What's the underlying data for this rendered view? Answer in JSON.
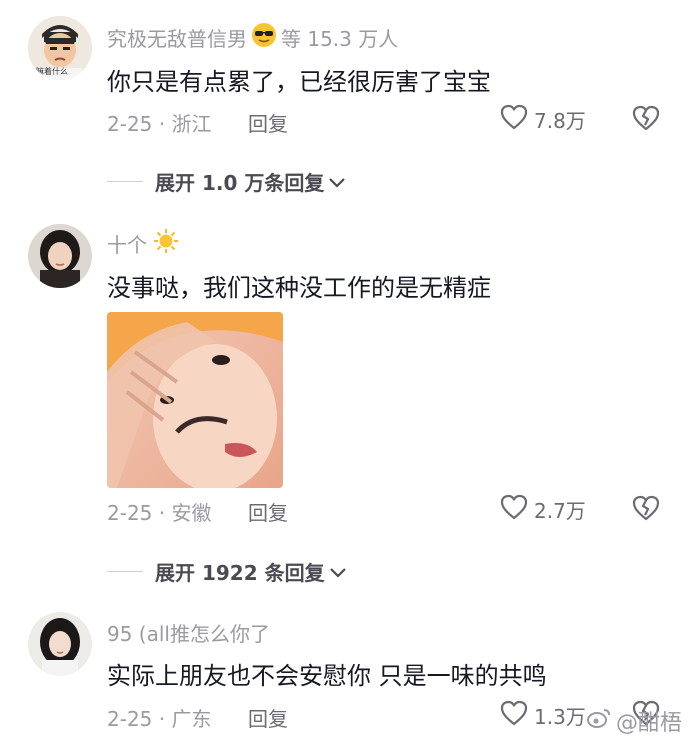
{
  "comments": [
    {
      "username": "究极无敌普信男",
      "emoji": "sunglasses-emoji",
      "username_suffix": "等 15.3 万人",
      "avatar_caption": "嘛着什么",
      "text": "你只是有点累了，已经很厉害了宝宝",
      "date_location": "2-25 · 浙江",
      "reply_label": "回复",
      "likes": "7.8万",
      "expand_label": "展开 1.0 万条回复"
    },
    {
      "username": "十个",
      "emoji": "sun-emoji",
      "text": "没事哒，我们这种没工作的是无精症",
      "date_location": "2-25 · 安徽",
      "reply_label": "回复",
      "likes": "2.7万",
      "expand_label": "展开 1922 条回复"
    },
    {
      "username": "95 (all推怎么你了",
      "text": "实际上朋友也不会安慰你 只是一味的共鸣",
      "date_location": "2-25 · 广东",
      "reply_label": "回复",
      "likes": "1.3万"
    }
  ],
  "watermark": "@酣梧",
  "colors": {
    "text_primary": "#161823",
    "text_secondary": "#9a9aa3",
    "background": "#ffffff"
  }
}
